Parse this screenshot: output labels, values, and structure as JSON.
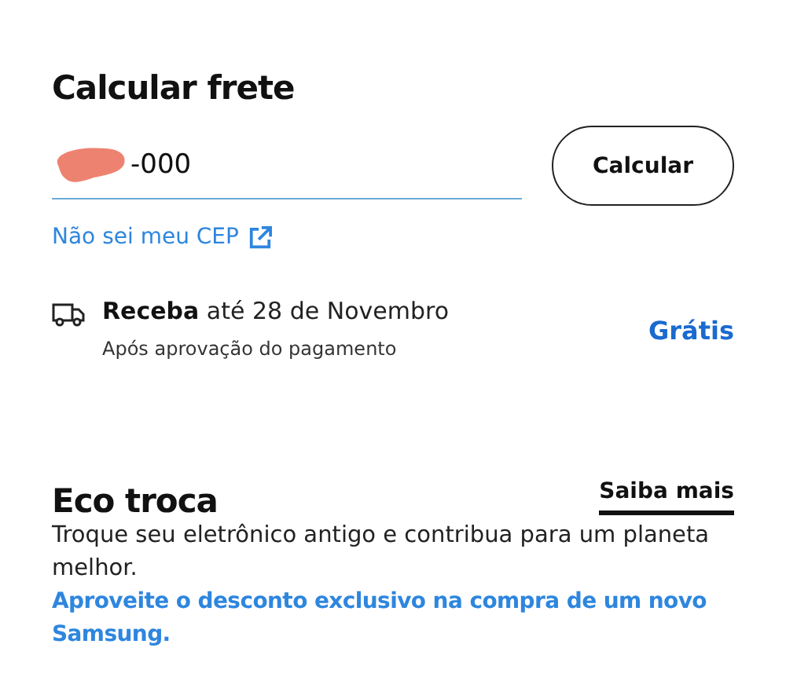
{
  "shipping": {
    "title": "Calcular frete",
    "cep_value": "-000",
    "redacted": true,
    "calculate_button": "Calcular",
    "cep_help_link": "Não sei meu CEP"
  },
  "delivery": {
    "lead": "Receba",
    "rest": " até 28 de Novembro",
    "note": "Após aprovação do pagamento",
    "price": "Grátis"
  },
  "eco": {
    "title": "Eco troca",
    "more_link": "Saiba mais",
    "text": "Troque seu eletrônico antigo e contribua para um planeta melhor.",
    "promo": "Aproveite o desconto exclusivo na compra de um novo Samsung."
  }
}
